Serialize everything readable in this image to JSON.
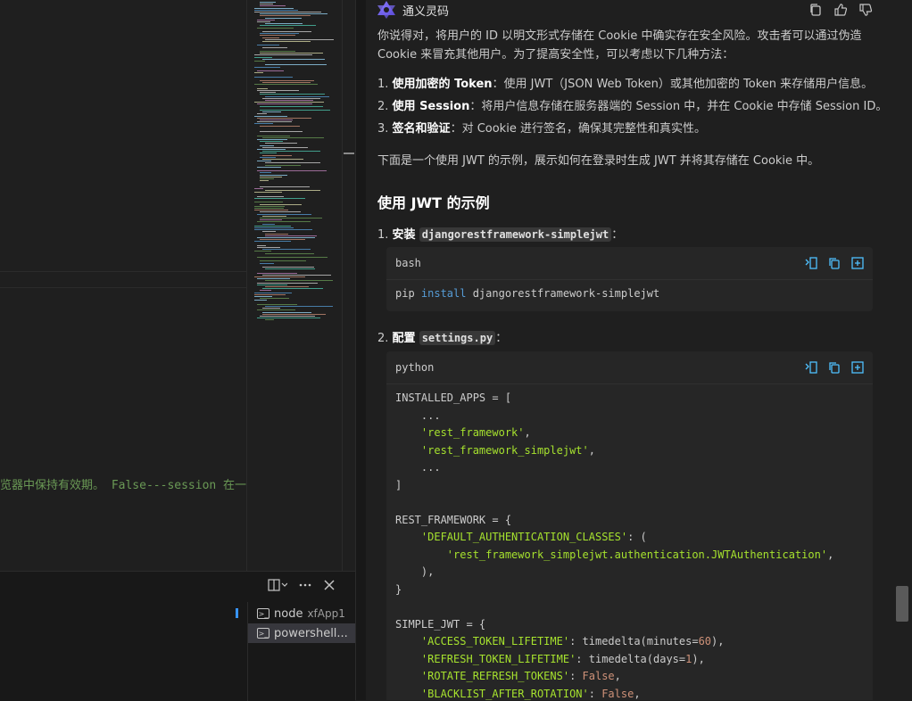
{
  "editor": {
    "visible_line": "览器中保持有效期。 False---session 在一"
  },
  "terminal": {
    "sessions": [
      {
        "name": "node",
        "sub": "xfApp1"
      },
      {
        "name": "powershell...",
        "sub": ""
      }
    ]
  },
  "chat": {
    "assistant_name": "通义灵码",
    "intro": "你说得对，将用户的 ID 以明文形式存储在 Cookie 中确实存在安全风险。攻击者可以通过伪造 Cookie 来冒充其他用户。为了提高安全性，可以考虑以下几种方法：",
    "methods": [
      {
        "num": "1.",
        "title": "使用加密的 Token",
        "text": "：使用 JWT（JSON Web Token）或其他加密的 Token 来存储用户信息。"
      },
      {
        "num": "2.",
        "title": "使用 Session",
        "text": "：将用户信息存储在服务器端的 Session 中，并在 Cookie 中存储 Session ID。"
      },
      {
        "num": "3.",
        "title": "签名和验证",
        "text": "：对 Cookie 进行签名，确保其完整性和真实性。"
      }
    ],
    "example_intro": "下面是一个使用 JWT 的示例，展示如何在登录时生成 JWT 并将其存储在 Cookie 中。",
    "section_title": "使用 JWT 的示例",
    "steps": [
      {
        "num": "1.",
        "title": "安装",
        "code": "djangorestframework-simplejwt",
        "suffix": "："
      },
      {
        "num": "2.",
        "title": "配置",
        "code": "settings.py",
        "suffix": "："
      }
    ],
    "code_blocks": [
      {
        "language": "bash",
        "code": "pip install djangorestframework-simplejwt"
      },
      {
        "language": "python"
      }
    ]
  }
}
